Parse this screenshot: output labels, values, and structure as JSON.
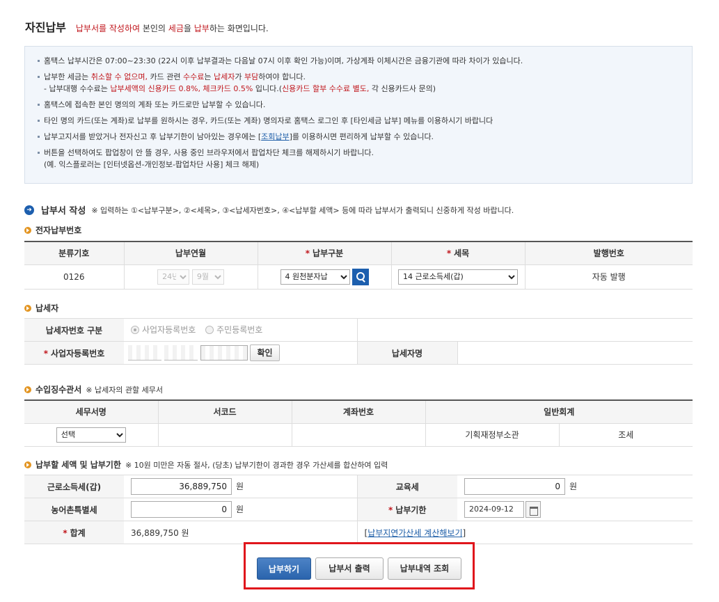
{
  "header": {
    "title": "자진납부",
    "desc_part1": "납부서를 작성하여",
    "desc_part2": " 본인의 ",
    "desc_part3": "세금",
    "desc_part4": "을 ",
    "desc_part5": "납부",
    "desc_part6": "하는 화면입니다."
  },
  "notice": {
    "item1": "홈택스 납부시간은 07:00~23:30 (22시 이후 납부결과는 다음날 07시 이후 확인 가능)이며, 가상계좌 이체시간은 금융기관에 따라 차이가 있습니다.",
    "item2_a": "납부한 세금는 ",
    "item2_b": "취소할 수 없으며,",
    "item2_c": " 카드 관련 ",
    "item2_d": "수수료",
    "item2_e": "는 ",
    "item2_f": "납세자",
    "item2_g": "가 ",
    "item2_h": "부담",
    "item2_i": "하여야 합니다.",
    "item2_sub_a": "- 납부대행 수수료는 ",
    "item2_sub_b": "납부세액의 신용카드 0.8%, 체크카드 0.5%",
    "item2_sub_c": " 입니다.(",
    "item2_sub_d": "신용카드 할부 수수료 별도,",
    "item2_sub_e": " 각 신용카드사 문의)",
    "item3": "홈택스에 접속한 본인 명의의 계좌 또는 카드로만 납부할 수 있습니다.",
    "item4": "타인 명의 카드(또는 계좌)로 납부를 원하시는 경우, 카드(또는 계좌) 명의자로 홈택스 로그인 후 [타인세금 납부] 메뉴를 이용하시기 바랍니다",
    "item5_a": "납부고지서를 받았거나 전자신고 후 납부기한이 남아있는 경우에는 [",
    "item5_link": "조회납부",
    "item5_b": "]를 이용하시면 편리하게  납부할 수 있습니다.",
    "item6": "버튼을 선택하여도 팝업창이 안 뜰 경우, 사용 중인 브라우저에서 팝업차단 체크를 해제하시기 바랍니다.",
    "item6_sub": "(예. 익스플로러는 [인터넷옵션-개인정보-팝업차단 사용] 체크 해제)"
  },
  "form": {
    "title": "납부서 작성",
    "desc": "※ 입력하는 ①<납부구분>, ②<세목>, ③<납세자번호>, ④<납부할 세액> 등에 따라 납부서가 출력되니 신중하게 작성 바랍니다."
  },
  "section1": {
    "title": "전자납부번호",
    "headers": [
      "분류기호",
      "납부연월",
      "납부구분",
      "세목",
      "발행번호"
    ],
    "class_code": "0126",
    "year": "24년",
    "month": "9월",
    "pay_type": "4 원천분자납",
    "tax_item": "14 근로소득세(갑)",
    "issue_no": "자동 발행"
  },
  "section2": {
    "title": "납세자",
    "row1_label": "납세자번호 구분",
    "radio1": "사업자등록번호",
    "radio2": "주민등록번호",
    "row2_label": "사업자등록번호",
    "confirm": "확인",
    "name_label": "납세자명",
    "name_value": ""
  },
  "section3": {
    "title": "수입징수관서",
    "note": "※ 납세자의 관할 세무서",
    "headers": [
      "세무서명",
      "서코드",
      "계좌번호",
      "일반회계"
    ],
    "office_select": "선택",
    "code": "",
    "account": "",
    "general_1": "기획재정부소관",
    "general_2": "조세"
  },
  "section4": {
    "title": "납부할 세액 및 납부기한",
    "note": "※ 10원 미만은 자동 절사, (당초) 납부기한이 경과한 경우 가산세를 합산하여 입력",
    "label1": "근로소득세(갑)",
    "value1": "36,889,750",
    "label2": "교육세",
    "value2": "0",
    "label3": "농어촌특별세",
    "value3": "0",
    "label4": "납부기한",
    "value4": "2024-09-12",
    "label5": "합계",
    "value5": "36,889,750  원",
    "link_open": "[",
    "link": "납부지연가산세 계산해보기",
    "link_close": "]",
    "unit": "원"
  },
  "buttons": {
    "pay": "납부하기",
    "print": "납부서 출력",
    "history": "납부내역 조회"
  }
}
